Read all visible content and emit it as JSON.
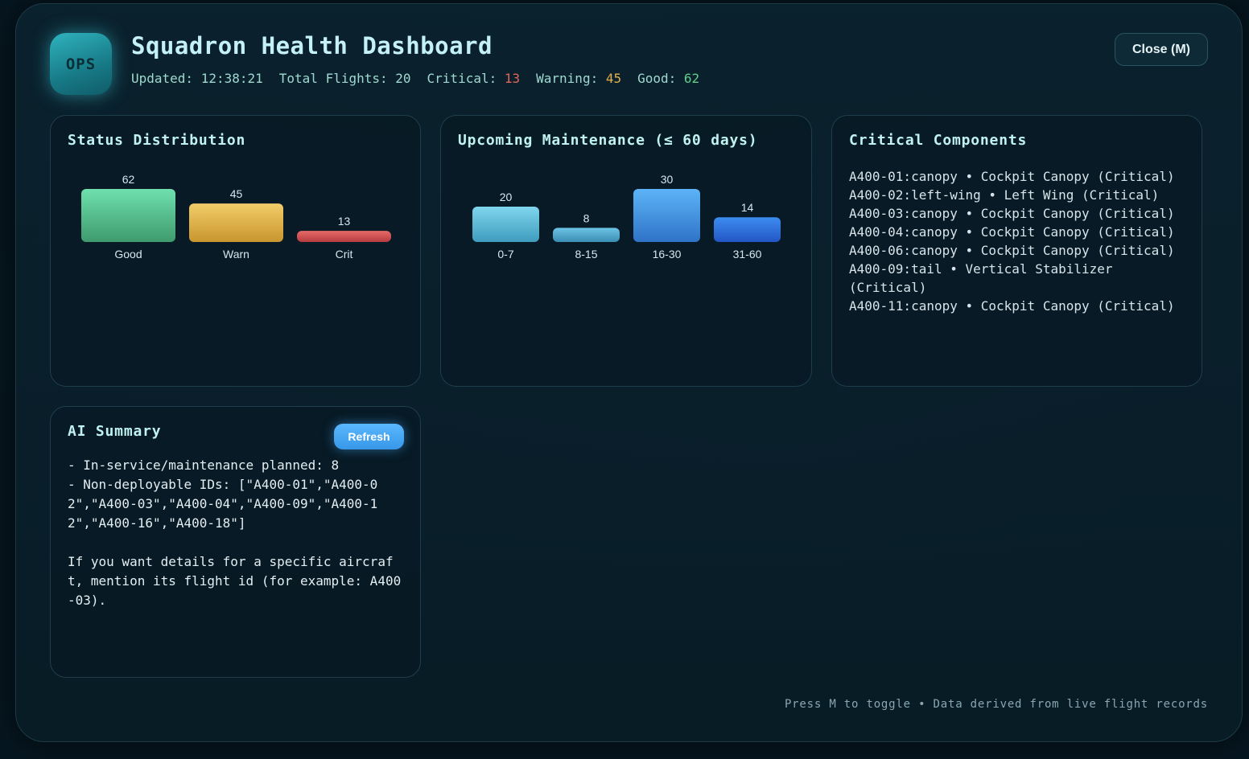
{
  "header": {
    "logo_text": "OPS",
    "title": "Squadron Health Dashboard",
    "updated_label": "Updated:",
    "updated_value": "12:38:21",
    "total_label": "Total Flights:",
    "total_value": "20",
    "critical_label": "Critical:",
    "critical_value": "13",
    "warning_label": "Warning:",
    "warning_value": "45",
    "good_label": "Good:",
    "good_value": "62",
    "close_label": "Close (M)"
  },
  "status_card": {
    "title": "Status Distribution"
  },
  "maintenance_card": {
    "title": "Upcoming Maintenance (≤ 60 days)"
  },
  "critical_card": {
    "title": "Critical Components",
    "items": [
      "A400-01:canopy • Cockpit Canopy (Critical)",
      "A400-02:left-wing • Left Wing (Critical)",
      "A400-03:canopy • Cockpit Canopy (Critical)",
      "A400-04:canopy • Cockpit Canopy (Critical)",
      "A400-06:canopy • Cockpit Canopy (Critical)",
      "A400-09:tail • Vertical Stabilizer (Critical)",
      "A400-11:canopy • Cockpit Canopy (Critical)"
    ]
  },
  "summary_card": {
    "title": "AI Summary",
    "refresh_label": "Refresh",
    "text": "- In-service/maintenance planned: 8\n- Non-deployable IDs: [\"A400-01\",\"A400-02\",\"A400-03\",\"A400-04\",\"A400-09\",\"A400-12\",\"A400-16\",\"A400-18\"]\n\nIf you want details for a specific aircraft, mention its flight id (for example: A400-03)."
  },
  "footer": {
    "text": "Press M to toggle • Data derived from live flight records"
  },
  "chart_data": [
    {
      "type": "bar",
      "title": "Status Distribution",
      "categories": [
        "Good",
        "Warn",
        "Crit"
      ],
      "values": [
        62,
        45,
        13
      ],
      "colors": [
        [
          "#6fe0ae",
          "#3f9a6d"
        ],
        [
          "#f2cd6a",
          "#c8962e"
        ],
        [
          "#e66a68",
          "#b63b3e"
        ]
      ]
    },
    {
      "type": "bar",
      "title": "Upcoming Maintenance (≤ 60 days)",
      "categories": [
        "0-7",
        "8-15",
        "16-30",
        "31-60"
      ],
      "values": [
        20,
        8,
        30,
        14
      ],
      "colors": [
        [
          "#7fd6ee",
          "#3f9cbd"
        ],
        [
          "#6cc4e6",
          "#3a8db3"
        ],
        [
          "#5cb4f7",
          "#2f73c7"
        ],
        [
          "#3c8cf0",
          "#2356c4"
        ]
      ]
    }
  ]
}
